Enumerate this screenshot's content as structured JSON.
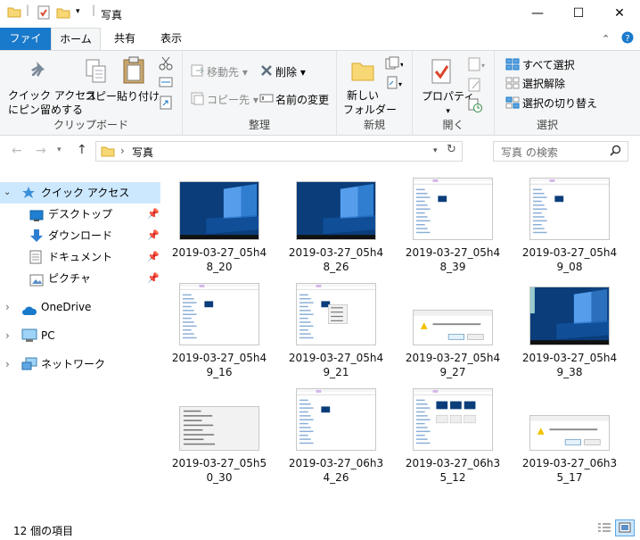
{
  "window": {
    "title": "写真",
    "minimize": "—",
    "maximize": "☐",
    "close": "✕"
  },
  "tabs": [
    {
      "label": "ファイル"
    },
    {
      "label": "ホーム"
    },
    {
      "label": "共有"
    },
    {
      "label": "表示"
    }
  ],
  "ribbon": {
    "clipboard": {
      "group": "クリップボード",
      "pin_line1": "クイック アクセス",
      "pin_line2": "にピン留めする",
      "copy": "コピー",
      "paste": "貼り付け"
    },
    "organize": {
      "group": "整理",
      "move_to": "移動先",
      "copy_to": "コピー先",
      "delete": "削除",
      "rename": "名前の変更"
    },
    "new": {
      "group": "新規",
      "new_folder_line1": "新しい",
      "new_folder_line2": "フォルダー"
    },
    "open": {
      "group": "開く",
      "properties": "プロパティ"
    },
    "select": {
      "group": "選択",
      "select_all": "すべて選択",
      "select_none": "選択解除",
      "invert": "選択の切り替え"
    }
  },
  "address": {
    "path": "写真",
    "search_placeholder": "写真 の検索"
  },
  "nav": {
    "quick_access": "クイック アクセス",
    "desktop": "デスクトップ",
    "downloads": "ダウンロード",
    "documents": "ドキュメント",
    "pictures": "ピクチャ",
    "onedrive": "OneDrive",
    "pc": "PC",
    "network": "ネットワーク"
  },
  "files": [
    {
      "name": "2019-03-27_05h48_20",
      "kind": "desktop"
    },
    {
      "name": "2019-03-27_05h48_26",
      "kind": "desktop"
    },
    {
      "name": "2019-03-27_05h48_39",
      "kind": "explorer"
    },
    {
      "name": "2019-03-27_05h49_08",
      "kind": "explorer"
    },
    {
      "name": "2019-03-27_05h49_16",
      "kind": "explorer"
    },
    {
      "name": "2019-03-27_05h49_21",
      "kind": "explorer-menu"
    },
    {
      "name": "2019-03-27_05h49_27",
      "kind": "dialog"
    },
    {
      "name": "2019-03-27_05h49_38",
      "kind": "desktop-window"
    },
    {
      "name": "2019-03-27_05h50_30",
      "kind": "menu"
    },
    {
      "name": "2019-03-27_06h34_26",
      "kind": "explorer"
    },
    {
      "name": "2019-03-27_06h35_12",
      "kind": "explorer-thumbs"
    },
    {
      "name": "2019-03-27_06h35_17",
      "kind": "dialog"
    }
  ],
  "status": {
    "count": "12 個の項目"
  },
  "colors": {
    "accent": "#1979ca",
    "selection": "#cce8ff",
    "desktop_blue": "#0a3d7a"
  }
}
